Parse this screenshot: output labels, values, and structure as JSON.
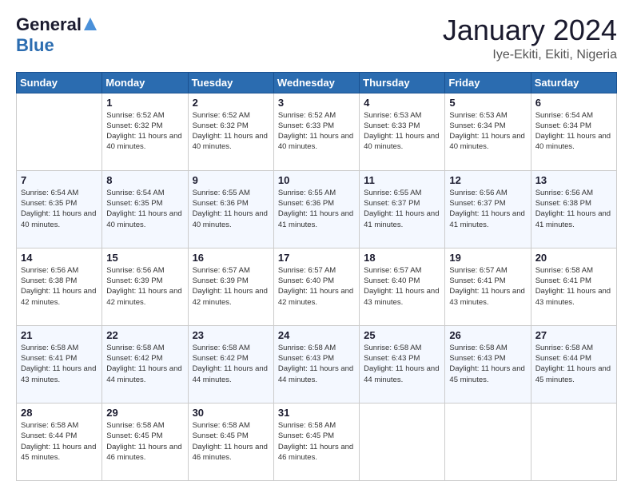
{
  "logo": {
    "general": "General",
    "blue": "Blue"
  },
  "header": {
    "month": "January 2024",
    "location": "Iye-Ekiti, Ekiti, Nigeria"
  },
  "columns": [
    "Sunday",
    "Monday",
    "Tuesday",
    "Wednesday",
    "Thursday",
    "Friday",
    "Saturday"
  ],
  "weeks": [
    [
      {
        "day": "",
        "info": ""
      },
      {
        "day": "1",
        "info": "Sunrise: 6:52 AM\nSunset: 6:32 PM\nDaylight: 11 hours and 40 minutes."
      },
      {
        "day": "2",
        "info": "Sunrise: 6:52 AM\nSunset: 6:32 PM\nDaylight: 11 hours and 40 minutes."
      },
      {
        "day": "3",
        "info": "Sunrise: 6:52 AM\nSunset: 6:33 PM\nDaylight: 11 hours and 40 minutes."
      },
      {
        "day": "4",
        "info": "Sunrise: 6:53 AM\nSunset: 6:33 PM\nDaylight: 11 hours and 40 minutes."
      },
      {
        "day": "5",
        "info": "Sunrise: 6:53 AM\nSunset: 6:34 PM\nDaylight: 11 hours and 40 minutes."
      },
      {
        "day": "6",
        "info": "Sunrise: 6:54 AM\nSunset: 6:34 PM\nDaylight: 11 hours and 40 minutes."
      }
    ],
    [
      {
        "day": "7",
        "info": "Sunrise: 6:54 AM\nSunset: 6:35 PM\nDaylight: 11 hours and 40 minutes."
      },
      {
        "day": "8",
        "info": "Sunrise: 6:54 AM\nSunset: 6:35 PM\nDaylight: 11 hours and 40 minutes."
      },
      {
        "day": "9",
        "info": "Sunrise: 6:55 AM\nSunset: 6:36 PM\nDaylight: 11 hours and 40 minutes."
      },
      {
        "day": "10",
        "info": "Sunrise: 6:55 AM\nSunset: 6:36 PM\nDaylight: 11 hours and 41 minutes."
      },
      {
        "day": "11",
        "info": "Sunrise: 6:55 AM\nSunset: 6:37 PM\nDaylight: 11 hours and 41 minutes."
      },
      {
        "day": "12",
        "info": "Sunrise: 6:56 AM\nSunset: 6:37 PM\nDaylight: 11 hours and 41 minutes."
      },
      {
        "day": "13",
        "info": "Sunrise: 6:56 AM\nSunset: 6:38 PM\nDaylight: 11 hours and 41 minutes."
      }
    ],
    [
      {
        "day": "14",
        "info": "Sunrise: 6:56 AM\nSunset: 6:38 PM\nDaylight: 11 hours and 42 minutes."
      },
      {
        "day": "15",
        "info": "Sunrise: 6:56 AM\nSunset: 6:39 PM\nDaylight: 11 hours and 42 minutes."
      },
      {
        "day": "16",
        "info": "Sunrise: 6:57 AM\nSunset: 6:39 PM\nDaylight: 11 hours and 42 minutes."
      },
      {
        "day": "17",
        "info": "Sunrise: 6:57 AM\nSunset: 6:40 PM\nDaylight: 11 hours and 42 minutes."
      },
      {
        "day": "18",
        "info": "Sunrise: 6:57 AM\nSunset: 6:40 PM\nDaylight: 11 hours and 43 minutes."
      },
      {
        "day": "19",
        "info": "Sunrise: 6:57 AM\nSunset: 6:41 PM\nDaylight: 11 hours and 43 minutes."
      },
      {
        "day": "20",
        "info": "Sunrise: 6:58 AM\nSunset: 6:41 PM\nDaylight: 11 hours and 43 minutes."
      }
    ],
    [
      {
        "day": "21",
        "info": "Sunrise: 6:58 AM\nSunset: 6:41 PM\nDaylight: 11 hours and 43 minutes."
      },
      {
        "day": "22",
        "info": "Sunrise: 6:58 AM\nSunset: 6:42 PM\nDaylight: 11 hours and 44 minutes."
      },
      {
        "day": "23",
        "info": "Sunrise: 6:58 AM\nSunset: 6:42 PM\nDaylight: 11 hours and 44 minutes."
      },
      {
        "day": "24",
        "info": "Sunrise: 6:58 AM\nSunset: 6:43 PM\nDaylight: 11 hours and 44 minutes."
      },
      {
        "day": "25",
        "info": "Sunrise: 6:58 AM\nSunset: 6:43 PM\nDaylight: 11 hours and 44 minutes."
      },
      {
        "day": "26",
        "info": "Sunrise: 6:58 AM\nSunset: 6:43 PM\nDaylight: 11 hours and 45 minutes."
      },
      {
        "day": "27",
        "info": "Sunrise: 6:58 AM\nSunset: 6:44 PM\nDaylight: 11 hours and 45 minutes."
      }
    ],
    [
      {
        "day": "28",
        "info": "Sunrise: 6:58 AM\nSunset: 6:44 PM\nDaylight: 11 hours and 45 minutes."
      },
      {
        "day": "29",
        "info": "Sunrise: 6:58 AM\nSunset: 6:45 PM\nDaylight: 11 hours and 46 minutes."
      },
      {
        "day": "30",
        "info": "Sunrise: 6:58 AM\nSunset: 6:45 PM\nDaylight: 11 hours and 46 minutes."
      },
      {
        "day": "31",
        "info": "Sunrise: 6:58 AM\nSunset: 6:45 PM\nDaylight: 11 hours and 46 minutes."
      },
      {
        "day": "",
        "info": ""
      },
      {
        "day": "",
        "info": ""
      },
      {
        "day": "",
        "info": ""
      }
    ]
  ]
}
